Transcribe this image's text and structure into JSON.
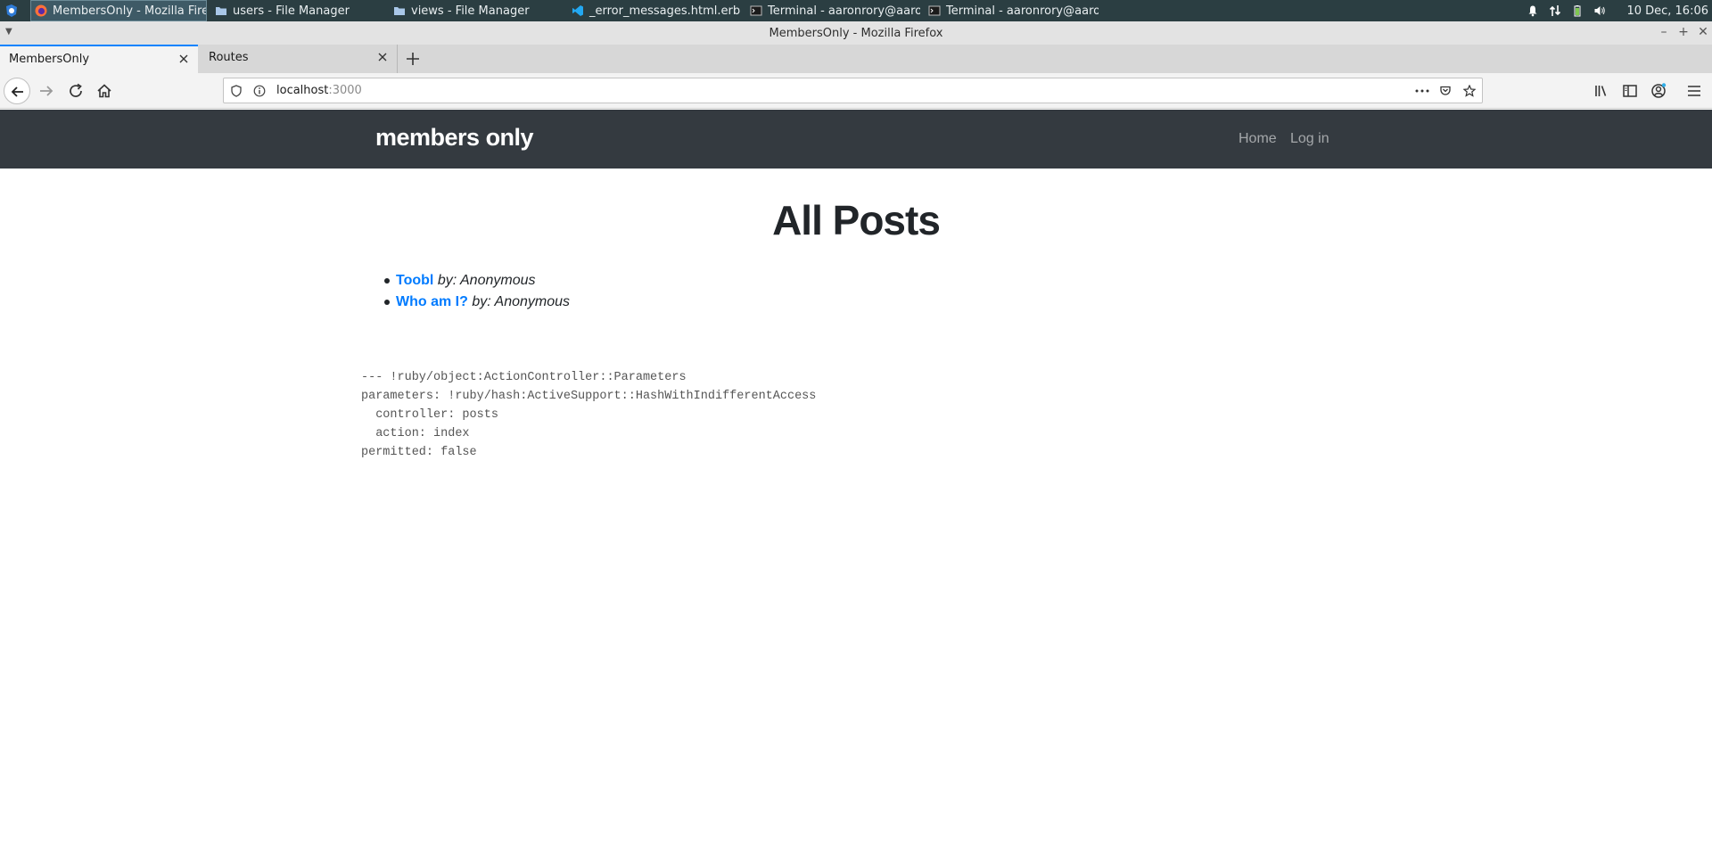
{
  "os_taskbar": {
    "tasks": [
      {
        "label": "MembersOnly - Mozilla Firefox",
        "icon": "firefox-icon",
        "active": true
      },
      {
        "label": "users - File Manager",
        "icon": "folder-icon",
        "active": false
      },
      {
        "label": "views - File Manager",
        "icon": "folder-icon",
        "active": false
      },
      {
        "label": "_error_messages.html.erb - ...",
        "icon": "vscode-icon",
        "active": false
      },
      {
        "label": "Terminal - aaronrory@aaron...",
        "icon": "terminal-icon",
        "active": false
      },
      {
        "label": "Terminal - aaronrory@aaron...",
        "icon": "terminal-icon",
        "active": false
      }
    ],
    "clock": "10 Dec, 16:06",
    "tray_icons": [
      "bell-icon",
      "network-icon",
      "battery-icon",
      "volume-icon"
    ]
  },
  "window": {
    "title": "MembersOnly - Mozilla Firefox"
  },
  "browser": {
    "tabs": [
      {
        "label": "MembersOnly",
        "active": true
      },
      {
        "label": "Routes",
        "active": false
      }
    ],
    "url_host": "localhost",
    "url_port": ":3000"
  },
  "site": {
    "brand": "members only",
    "nav": [
      "Home",
      "Log in"
    ],
    "title": "All Posts",
    "posts": [
      {
        "title": "Toobl",
        "author": "by: Anonymous"
      },
      {
        "title": "Who am I?",
        "author": "by: Anonymous"
      }
    ],
    "debug_lines": [
      "--- !ruby/object:ActionController::Parameters",
      "parameters: !ruby/hash:ActiveSupport::HashWithIndifferentAccess",
      "  controller: posts",
      "  action: index",
      "permitted: false"
    ]
  },
  "colors": {
    "taskbar": "#2b3e42",
    "site_navbar": "#343a40",
    "link": "#007bff",
    "tab_accent": "#0a84ff"
  }
}
